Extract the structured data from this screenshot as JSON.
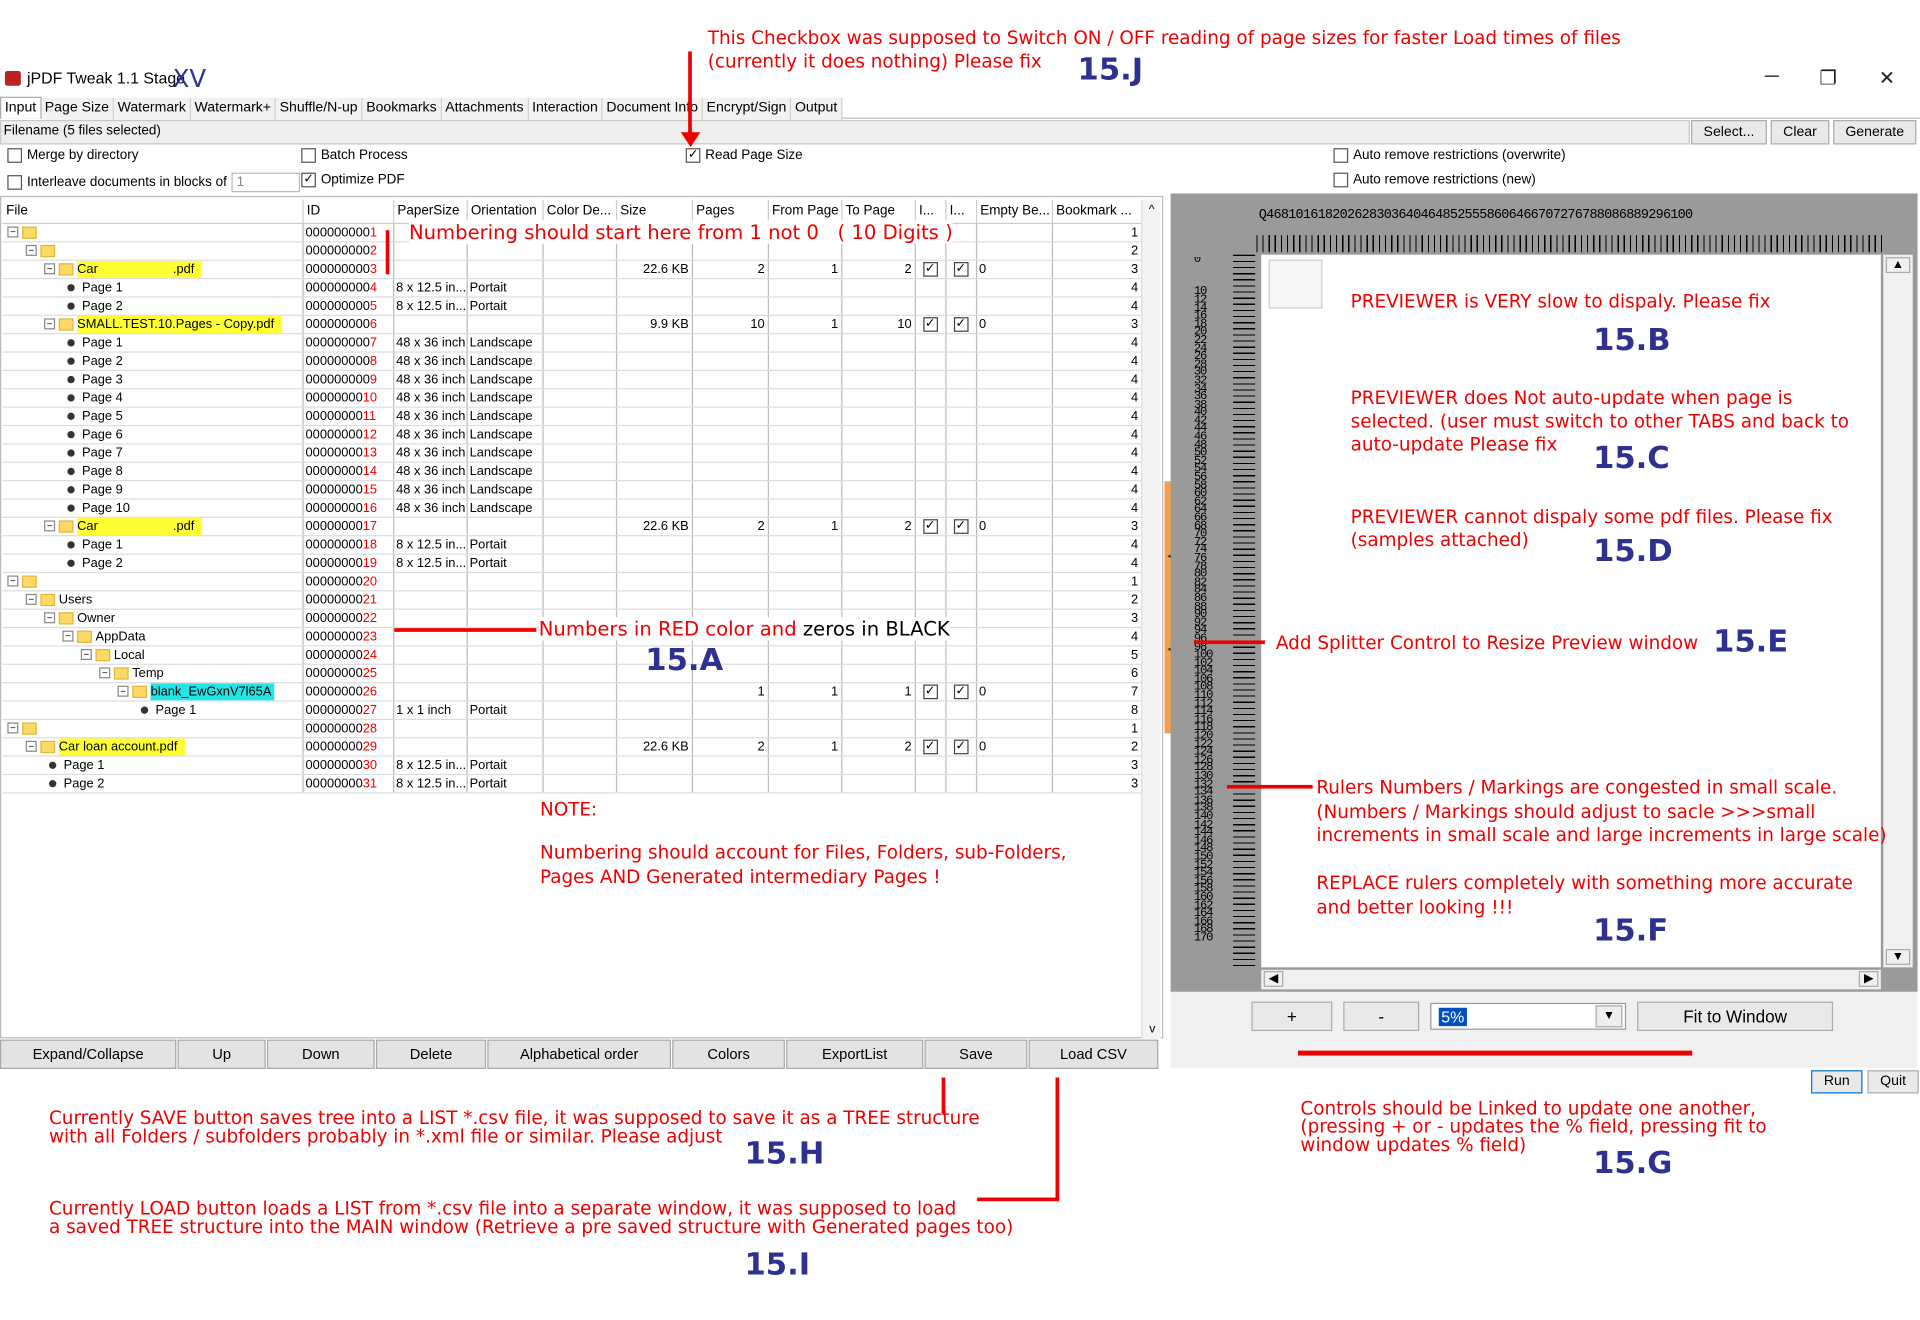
{
  "title": "jPDF Tweak 1.1 Stage",
  "title_suffix": "XV",
  "window_controls": {
    "min": "─",
    "max": "❐",
    "close": "✕"
  },
  "tabs": [
    "Input",
    "Page Size",
    "Watermark",
    "Watermark+",
    "Shuffle/N-up",
    "Bookmarks",
    "Attachments",
    "Interaction",
    "Document Info",
    "Encrypt/Sign",
    "Output"
  ],
  "filename": {
    "label": "Filename",
    "value": "(5 files selected)"
  },
  "file_buttons": {
    "select": "Select...",
    "clear": "Clear",
    "generate": "Generate"
  },
  "options": {
    "merge": "Merge by directory",
    "interleave": "Interleave documents in blocks of",
    "interleave_value": "1",
    "batch": "Batch Process",
    "optimize": "Optimize PDF",
    "read_page_size": "Read Page Size",
    "auto_overwrite": "Auto remove restrictions (overwrite)",
    "auto_new": "Auto remove restrictions (new)"
  },
  "columns": [
    "File",
    "ID",
    "PaperSize",
    "Orientation",
    "Color De...",
    "Size",
    "Pages",
    "From Page",
    "To Page",
    "I...",
    "I...",
    "Empty Be...",
    "Bookmark ..."
  ],
  "rows": [
    {
      "file": "",
      "lvl": 0,
      "kind": "folder",
      "tg": "−",
      "idz": "000000000",
      "idn": "1",
      "bm": "1"
    },
    {
      "file": "",
      "lvl": 1,
      "kind": "folder",
      "tg": "−",
      "idz": "000000000",
      "idn": "2",
      "bm": "2"
    },
    {
      "file": "Car                     .pdf",
      "lvl": 2,
      "kind": "folder",
      "tg": "−",
      "hl": "y",
      "idz": "000000000",
      "idn": "3",
      "size": "22.6 KB",
      "pages": "2",
      "from": "1",
      "to": "2",
      "c1": "✓",
      "c2": "✓",
      "empty": "0",
      "bm": "3"
    },
    {
      "file": "Page 1",
      "lvl": 3,
      "kind": "page",
      "idz": "000000000",
      "idn": "4",
      "paper": "8 x 12.5 in...",
      "orient": "Portait",
      "bm": "4"
    },
    {
      "file": "Page 2",
      "lvl": 3,
      "kind": "page",
      "idz": "000000000",
      "idn": "5",
      "paper": "8 x 12.5 in...",
      "orient": "Portait",
      "bm": "4"
    },
    {
      "file": "SMALL.TEST.10.Pages - Copy.pdf",
      "lvl": 2,
      "kind": "folder",
      "tg": "−",
      "hl": "y",
      "idz": "000000000",
      "idn": "6",
      "size": "9.9 KB",
      "pages": "10",
      "from": "1",
      "to": "10",
      "c1": "✓",
      "c2": "✓",
      "empty": "0",
      "bm": "3"
    },
    {
      "file": "Page 1",
      "lvl": 3,
      "kind": "page",
      "idz": "000000000",
      "idn": "7",
      "paper": "48 x 36 inch",
      "orient": "Landscape",
      "bm": "4"
    },
    {
      "file": "Page 2",
      "lvl": 3,
      "kind": "page",
      "idz": "000000000",
      "idn": "8",
      "paper": "48 x 36 inch",
      "orient": "Landscape",
      "bm": "4"
    },
    {
      "file": "Page 3",
      "lvl": 3,
      "kind": "page",
      "idz": "000000000",
      "idn": "9",
      "paper": "48 x 36 inch",
      "orient": "Landscape",
      "bm": "4"
    },
    {
      "file": "Page 4",
      "lvl": 3,
      "kind": "page",
      "idz": "00000000",
      "idn": "10",
      "paper": "48 x 36 inch",
      "orient": "Landscape",
      "bm": "4"
    },
    {
      "file": "Page 5",
      "lvl": 3,
      "kind": "page",
      "idz": "00000000",
      "idn": "11",
      "paper": "48 x 36 inch",
      "orient": "Landscape",
      "bm": "4"
    },
    {
      "file": "Page 6",
      "lvl": 3,
      "kind": "page",
      "idz": "00000000",
      "idn": "12",
      "paper": "48 x 36 inch",
      "orient": "Landscape",
      "bm": "4"
    },
    {
      "file": "Page 7",
      "lvl": 3,
      "kind": "page",
      "idz": "00000000",
      "idn": "13",
      "paper": "48 x 36 inch",
      "orient": "Landscape",
      "bm": "4"
    },
    {
      "file": "Page 8",
      "lvl": 3,
      "kind": "page",
      "idz": "00000000",
      "idn": "14",
      "paper": "48 x 36 inch",
      "orient": "Landscape",
      "bm": "4"
    },
    {
      "file": "Page 9",
      "lvl": 3,
      "kind": "page",
      "idz": "00000000",
      "idn": "15",
      "paper": "48 x 36 inch",
      "orient": "Landscape",
      "bm": "4"
    },
    {
      "file": "Page 10",
      "lvl": 3,
      "kind": "page",
      "idz": "00000000",
      "idn": "16",
      "paper": "48 x 36 inch",
      "orient": "Landscape",
      "bm": "4"
    },
    {
      "file": "Car                     .pdf",
      "lvl": 2,
      "kind": "folder",
      "tg": "−",
      "hl": "y",
      "idz": "00000000",
      "idn": "17",
      "size": "22.6 KB",
      "pages": "2",
      "from": "1",
      "to": "2",
      "c1": "✓",
      "c2": "✓",
      "empty": "0",
      "bm": "3"
    },
    {
      "file": "Page 1",
      "lvl": 3,
      "kind": "page",
      "idz": "00000000",
      "idn": "18",
      "paper": "8 x 12.5 in...",
      "orient": "Portait",
      "bm": "4"
    },
    {
      "file": "Page 2",
      "lvl": 3,
      "kind": "page",
      "idz": "00000000",
      "idn": "19",
      "paper": "8 x 12.5 in...",
      "orient": "Portait",
      "bm": "4"
    },
    {
      "file": "",
      "lvl": 0,
      "kind": "folder",
      "tg": "−",
      "idz": "00000000",
      "idn": "20",
      "bm": "1"
    },
    {
      "file": "Users",
      "lvl": 1,
      "kind": "folder",
      "tg": "−",
      "idz": "00000000",
      "idn": "21",
      "bm": "2"
    },
    {
      "file": "Owner",
      "lvl": 2,
      "kind": "folder",
      "tg": "−",
      "idz": "00000000",
      "idn": "22",
      "bm": "3"
    },
    {
      "file": "AppData",
      "lvl": 3,
      "kind": "folder",
      "tg": "−",
      "idz": "00000000",
      "idn": "23",
      "bm": "4"
    },
    {
      "file": "Local",
      "lvl": 4,
      "kind": "folder",
      "tg": "−",
      "idz": "00000000",
      "idn": "24",
      "bm": "5"
    },
    {
      "file": "Temp",
      "lvl": 5,
      "kind": "folder",
      "tg": "−",
      "idz": "00000000",
      "idn": "25",
      "bm": "6"
    },
    {
      "file": "blank_EwGxnV7l65A",
      "lvl": 6,
      "kind": "folder",
      "tg": "−",
      "hl": "c",
      "idz": "00000000",
      "idn": "26",
      "pages": "1",
      "from": "1",
      "to": "1",
      "c1": "✓",
      "c2": "✓",
      "empty": "0",
      "bm": "7"
    },
    {
      "file": "Page 1",
      "lvl": 7,
      "kind": "page",
      "idz": "00000000",
      "idn": "27",
      "paper": "1 x 1 inch",
      "orient": "Portait",
      "bm": "8"
    },
    {
      "file": "",
      "lvl": 0,
      "kind": "folder",
      "tg": "−",
      "idz": "00000000",
      "idn": "28",
      "bm": "1"
    },
    {
      "file": "Car loan account.pdf",
      "lvl": 1,
      "kind": "folder",
      "tg": "−",
      "hl": "y",
      "idz": "00000000",
      "idn": "29",
      "size": "22.6 KB",
      "pages": "2",
      "from": "1",
      "to": "2",
      "c1": "✓",
      "c2": "✓",
      "empty": "0",
      "bm": "2"
    },
    {
      "file": "Page 1",
      "lvl": 2,
      "kind": "page",
      "idz": "00000000",
      "idn": "30",
      "paper": "8 x 12.5 in...",
      "orient": "Portait",
      "bm": "3"
    },
    {
      "file": "Page 2",
      "lvl": 2,
      "kind": "page",
      "idz": "00000000",
      "idn": "31",
      "paper": "8 x 12.5 in...",
      "orient": "Portait",
      "bm": "3"
    }
  ],
  "bottom_buttons": [
    "Expand/Collapse",
    "Up",
    "Down",
    "Delete",
    "Alphabetical order",
    "Colors",
    "ExportList",
    "Save",
    "Load CSV"
  ],
  "preview": {
    "zoom": "5%",
    "plus": "+",
    "minus": "-",
    "fit": "Fit to Window",
    "ruler_top": "Q4681016182026283036404648525558606466707276788086889296100",
    "ruler_left": [
      "0",
      "",
      "",
      "",
      "10",
      "12",
      "14",
      "16",
      "18",
      "20",
      "22",
      "24",
      "26",
      "28",
      "30",
      "32",
      "34",
      "36",
      "38",
      "40",
      "42",
      "44",
      "46",
      "48",
      "50",
      "52",
      "54",
      "56",
      "58",
      "60",
      "62",
      "64",
      "66",
      "68",
      "70",
      "72",
      "74",
      "76",
      "78",
      "80",
      "82",
      "84",
      "86",
      "88",
      "90",
      "92",
      "94",
      "96",
      "98",
      "100",
      "102",
      "104",
      "106",
      "108",
      "110",
      "112",
      "114",
      "116",
      "118",
      "120",
      "122",
      "124",
      "126",
      "128",
      "130",
      "132",
      "134",
      "136",
      "138",
      "140",
      "142",
      "144",
      "146",
      "148",
      "150",
      "152",
      "154",
      "156",
      "158",
      "160",
      "162",
      "164",
      "166",
      "168",
      "170"
    ]
  },
  "run": "Run",
  "quit": "Quit",
  "annotations": {
    "j": "This Checkbox was supposed to Switch ON / OFF reading of page sizes for faster Load times of files\n(currently it does nothing) Please fix",
    "j_tag": "15.J",
    "num": "Numbering should start here from 1 not 0   ( 10 Digits )",
    "a_part1": "Numbers in RED color and ",
    "a_part2": "zeros in BLACK",
    "a_tag": "15.A",
    "note": "NOTE:",
    "note_body": "Numbering should account for Files, Folders, sub-Folders,\nPages AND Generated intermediary Pages !",
    "b": "PREVIEWER is VERY slow to dispaly. Please fix",
    "b_tag": "15.B",
    "c": "PREVIEWER does Not auto-update when page is\nselected. (user must switch to other TABS and back to\nauto-update Please fix",
    "c_tag": "15.C",
    "d": "PREVIEWER cannot dispaly some pdf files. Please fix\n(samples attached)",
    "d_tag": "15.D",
    "e": "Add Splitter Control to Resize Preview window",
    "e_tag": "15.E",
    "f": "Rulers Numbers / Markings are congested in small scale.\n(Numbers / Markings should adjust to sacle >>>small\nincrements in small scale and large increments in large scale)\n\nREPLACE rulers completely with something more accurate\nand better looking !!!",
    "f_tag": "15.F",
    "g": "Controls should be Linked to update one another,\n(pressing + or - updates the % field, pressing fit to\nwindow updates % field)",
    "g_tag": "15.G",
    "h": "Currently SAVE button saves tree into a LIST *.csv file, it was supposed to save it as a TREE structure\nwith all Folders / subfolders probably in *.xml file or similar. Please adjust",
    "h_tag": "15.H",
    "i": "Currently LOAD button loads a LIST from *.csv file into a separate window, it was supposed to load\na saved TREE structure into the MAIN window (Retrieve a pre saved structure with Generated pages too)",
    "i_tag": "15.I"
  },
  "colors": {
    "annotation": "#e00000",
    "tag": "#2e3192",
    "highlight_yellow": "#ffff33",
    "highlight_cyan": "#22e6e6"
  }
}
